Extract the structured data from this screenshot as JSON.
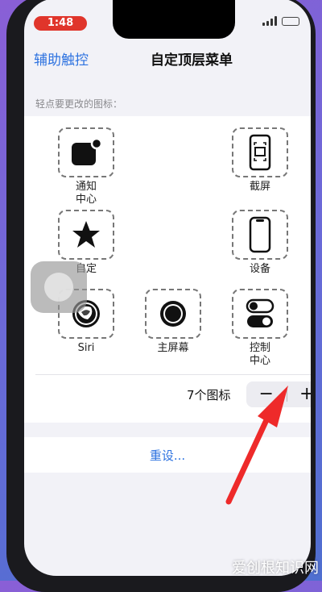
{
  "status": {
    "time": "1:48"
  },
  "nav": {
    "back_label": "辅助触控",
    "title": "自定顶层菜单"
  },
  "section_label": "轻点要更改的图标：",
  "icons": [
    {
      "label": "通知\n中心",
      "icon": "notification-center-icon"
    },
    {
      "label": "截屏",
      "icon": "screenshot-icon"
    },
    {
      "label": "自定",
      "icon": "star-icon"
    },
    {
      "label": "设备",
      "icon": "device-icon"
    },
    {
      "label": "Siri",
      "icon": "siri-icon"
    },
    {
      "label": "主屏幕",
      "icon": "home-icon"
    },
    {
      "label": "控制\n中心",
      "icon": "control-center-icon"
    }
  ],
  "count": {
    "label": "7个图标",
    "minus": "−",
    "plus": "+"
  },
  "reset": {
    "label": "重设..."
  },
  "watermark": "爱创根知识网"
}
